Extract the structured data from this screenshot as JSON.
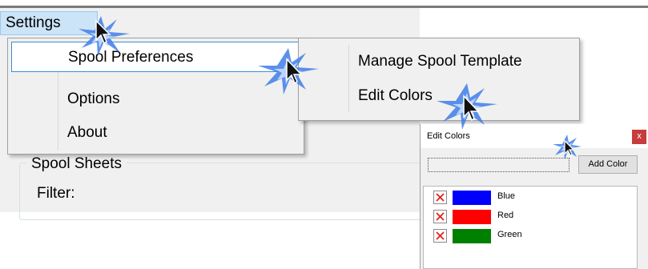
{
  "menubar": {
    "settings_label": "Settings"
  },
  "settings_menu": {
    "items": [
      {
        "label": "Spool Preferences"
      },
      {
        "label": "Options"
      },
      {
        "label": "About"
      }
    ]
  },
  "submenu": {
    "items": [
      {
        "label": "Manage Spool Template"
      },
      {
        "label": "Edit Colors"
      }
    ]
  },
  "background": {
    "group_title": "Spool Sheets",
    "filter_label": "Filter:"
  },
  "dialog": {
    "title": "Edit Colors",
    "close_glyph": "x",
    "color_input_value": "",
    "add_button": "Add Color",
    "colors": [
      {
        "name": "Blue",
        "hex": "#0000ff"
      },
      {
        "name": "Red",
        "hex": "#ff0000"
      },
      {
        "name": "Green",
        "hex": "#008000"
      }
    ]
  },
  "icons": {
    "delete": "close-icon",
    "pointer": "arrow-cursor-icon"
  },
  "accent_colors": {
    "highlight_border": "#3b8fd6",
    "menu_hover": "#cce4f7",
    "click_burst": "#2a6be0"
  }
}
